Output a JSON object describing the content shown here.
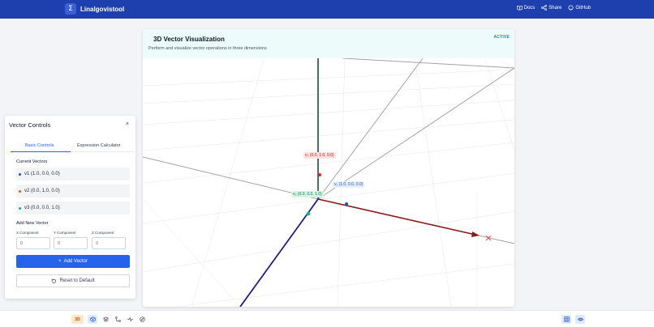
{
  "app": {
    "name": "Linalgovistool"
  },
  "nav": {
    "docs": "Docs",
    "share": "Share",
    "github": "GitHub"
  },
  "viz": {
    "title": "3D Vector Visualization",
    "subtitle": "Perform and visualize vector operations in three dimensions",
    "badge": "ACTIVE",
    "labels": {
      "v1": "v₁ (1.0, 0.0, 0.0)",
      "v2": "v₂ (0.0, 1.0, 0.0)",
      "v3": "v₃ (0.0, 0.0, 1.0)"
    }
  },
  "panel": {
    "title": "Vector Controls",
    "close": "×",
    "tabs": {
      "basic": "Basic Controls",
      "expression": "Expression Calculator"
    },
    "current_vectors_title": "Current Vectors",
    "vectors": [
      {
        "label": "v1 (1.0, 0.0, 0.0)",
        "color": "#1d4ed8"
      },
      {
        "label": "v2 (0.0, 1.0, 0.0)",
        "color": "#ea580c"
      },
      {
        "label": "v3 (0.0, 0.0, 1.0)",
        "color": "#10b981"
      }
    ],
    "add_new_title": "Add New Vector",
    "components": {
      "x_label": "X Component",
      "y_label": "Y Component",
      "z_label": "Z Component",
      "x_placeholder": "0",
      "y_placeholder": "0",
      "z_placeholder": "0"
    },
    "add_button": "Add Vector",
    "reset_button": "Reset to Default"
  },
  "toolbar": {
    "mode_3d": "3D"
  },
  "icons": {
    "logo": "sigma-icon",
    "docs": "book-icon",
    "share": "share-icon",
    "github": "github-icon",
    "cube": "cube-icon",
    "layers": "layers-icon",
    "route": "route-icon",
    "activity": "activity-icon",
    "compass": "compass-icon",
    "grid": "grid-icon",
    "eye": "eye-icon"
  },
  "colors": {
    "primary": "#2563eb",
    "header": "#1e40af",
    "x_axis": "#8b1a1a",
    "y_axis": "#14532d",
    "z_axis": "#1e1b8b"
  }
}
